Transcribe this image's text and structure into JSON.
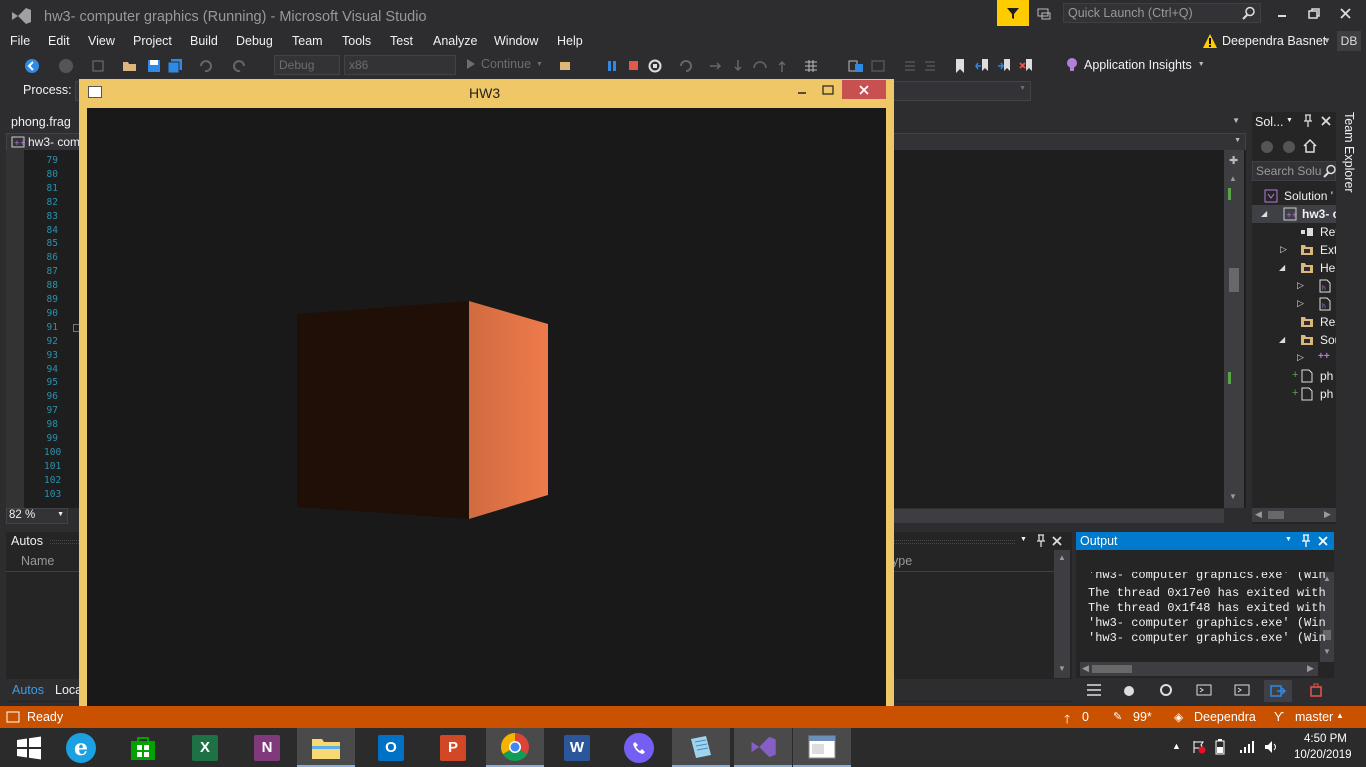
{
  "window": {
    "title": "hw3- computer graphics (Running) - Microsoft Visual Studio"
  },
  "quick_launch": {
    "placeholder": "Quick Launch (Ctrl+Q)"
  },
  "account": {
    "name": "Deependra Basnet",
    "initials": "DB"
  },
  "menu": [
    "File",
    "Edit",
    "View",
    "Project",
    "Build",
    "Debug",
    "Team",
    "Tools",
    "Test",
    "Analyze",
    "Window",
    "Help"
  ],
  "toolbar": {
    "config": "Debug",
    "platform": "x86",
    "continue_label": "Continue",
    "insights_label": "Application Insights"
  },
  "process": {
    "label": "Process:"
  },
  "editor": {
    "file_tab": "phong.frag",
    "nav_dropdown": "hw3- com",
    "zoom": "82 %",
    "line_numbers": [
      "79",
      "80",
      "81",
      "82",
      "83",
      "84",
      "85",
      "86",
      "87",
      "88",
      "89",
      "90",
      "91",
      "92",
      "93",
      "94",
      "95",
      "96",
      "97",
      "98",
      "99",
      "100",
      "101",
      "102",
      "103"
    ]
  },
  "solution_explorer": {
    "title": "Sol...",
    "search_placeholder": "Search Solu",
    "side_tab": "Team Explorer",
    "items": [
      "Solution '",
      "hw3- c",
      "Ref",
      "Ext",
      "He",
      "",
      "",
      "Res",
      "Sou",
      "",
      "ph",
      "ph"
    ]
  },
  "autos": {
    "title": "Autos",
    "col_name": "Name",
    "col_type": "ype",
    "tabs": [
      "Autos",
      "Loca"
    ]
  },
  "output": {
    "title": "Output",
    "lines": [
      "'hw3- computer graphics.exe' (Win",
      "The thread 0x17e0 has exited with",
      "The thread 0x1f48 has exited with",
      "'hw3- computer graphics.exe' (Win",
      "'hw3- computer graphics.exe' (Win"
    ]
  },
  "app_window": {
    "title": "HW3",
    "background": "#191919",
    "cube_front_color": "#1f0f07",
    "cube_side_color": "#e07a4a"
  },
  "status": {
    "ready": "Ready",
    "up_count": "0",
    "edits": "99*",
    "user": "Deependra",
    "branch": "master"
  },
  "taskbar": {
    "time": "4:50 PM",
    "date": "10/20/2019",
    "apps": [
      "start-button",
      "internet-explorer",
      "store",
      "excel",
      "onenote",
      "file-explorer",
      "outlook",
      "powerpoint",
      "chrome",
      "word",
      "viber",
      "notepad",
      "visual-studio",
      "hw3-app"
    ]
  },
  "colors": {
    "accent": "#007acc",
    "status_bar": "#ca5100",
    "window_frame": "#f0c766",
    "quick_launch_flag": "#ffcc00"
  }
}
